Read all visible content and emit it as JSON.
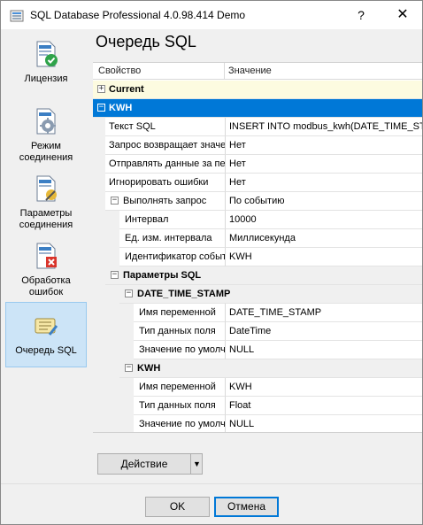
{
  "window": {
    "title": "SQL Database Professional 4.0.98.414 Demo",
    "help": "?",
    "close": "✕"
  },
  "sidebar": {
    "items": [
      {
        "label": "Лицензия",
        "icon": "license-check-icon"
      },
      {
        "label": "Режим соединения",
        "icon": "connection-mode-gear-icon"
      },
      {
        "label": "Параметры соединения",
        "icon": "connection-params-icon"
      },
      {
        "label": "Обработка ошибок",
        "icon": "error-handling-icon"
      },
      {
        "label": "Очередь SQL",
        "icon": "sql-queue-icon",
        "active": true
      }
    ]
  },
  "main": {
    "title": "Очередь SQL"
  },
  "grid": {
    "col_property": "Свойство",
    "col_value": "Значение",
    "rows": [
      {
        "kind": "cat",
        "name": "Current",
        "toggle": "+",
        "style": "current"
      },
      {
        "kind": "cat",
        "name": "KWH",
        "toggle": "−",
        "style": "selected"
      },
      {
        "kind": "prop",
        "name": "Текст SQL",
        "value": "INSERT INTO modbus_kwh(DATE_TIME_STAMP,KWH)"
      },
      {
        "kind": "prop",
        "name": "Запрос возвращает значения",
        "value": "Нет"
      },
      {
        "kind": "prop",
        "name": "Отправлять данные за период",
        "value": "Нет"
      },
      {
        "kind": "prop",
        "name": "Игнорировать ошибки",
        "value": "Нет"
      },
      {
        "kind": "prop",
        "name": "Выполнять запрос",
        "value": "По событию",
        "toggle": "−"
      },
      {
        "kind": "sub",
        "name": "Интервал",
        "value": "10000"
      },
      {
        "kind": "sub",
        "name": "Ед. изм. интервала",
        "value": "Миллисекунда"
      },
      {
        "kind": "sub",
        "name": "Идентификатор события",
        "value": "KWH"
      },
      {
        "kind": "subcat",
        "name": "Параметры SQL",
        "toggle": "−"
      },
      {
        "kind": "subsubcat",
        "name": "DATE_TIME_STAMP",
        "toggle": "−"
      },
      {
        "kind": "leaf",
        "name": "Имя переменной",
        "value": "DATE_TIME_STAMP"
      },
      {
        "kind": "leaf",
        "name": "Тип данных поля",
        "value": "DateTime"
      },
      {
        "kind": "leaf",
        "name": "Значение по умолчанию",
        "value": "NULL"
      },
      {
        "kind": "subsubcat",
        "name": "KWH",
        "toggle": "−"
      },
      {
        "kind": "leaf",
        "name": "Имя переменной",
        "value": "KWH"
      },
      {
        "kind": "leaf",
        "name": "Тип данных поля",
        "value": "Float"
      },
      {
        "kind": "leaf",
        "name": "Значение по умолчанию",
        "value": "NULL"
      }
    ]
  },
  "actions": {
    "action_label": "Действие",
    "ok_label": "OK",
    "cancel_label": "Отмена"
  },
  "colors": {
    "accent": "#0078d7",
    "current_bg": "#fdfbe0"
  }
}
